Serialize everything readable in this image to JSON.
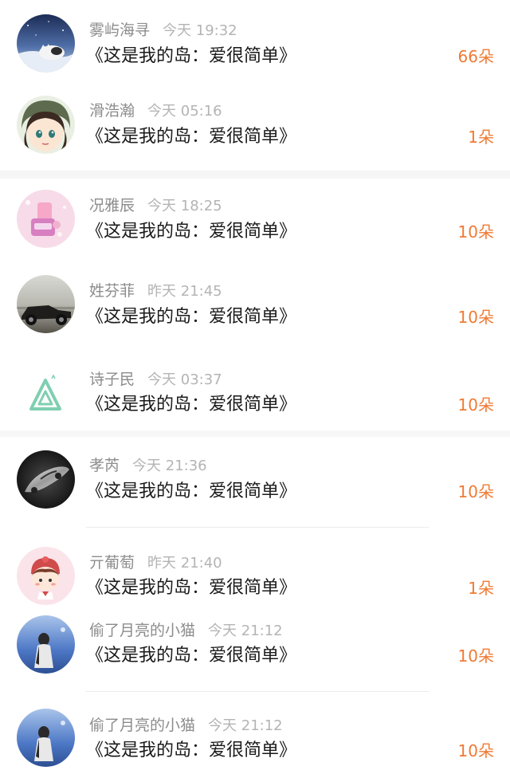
{
  "gift_list": [
    {
      "user": "雾屿海寻",
      "time": "今天 19:32",
      "song": "《这是我的岛：爱很简单》",
      "count": "66朵",
      "avatar": "cat-at-night-avatar"
    },
    {
      "user": "滑浩瀚",
      "time": "今天 05:16",
      "song": "《这是我的岛：爱很简单》",
      "count": "1朵",
      "avatar": "cartoon-girl-avatar"
    },
    {
      "user": "况雅辰",
      "time": "今天 18:25",
      "song": "《这是我的岛：爱很简单》",
      "count": "10朵",
      "avatar": "pink-candy-avatar"
    },
    {
      "user": "姓芬菲",
      "time": "昨天 21:45",
      "song": "《这是我的岛：爱很简单》",
      "count": "10朵",
      "avatar": "vintage-car-avatar"
    },
    {
      "user": "诗子民",
      "time": "今天 03:37",
      "song": "《这是我的岛：爱很简单》",
      "count": "10朵",
      "avatar": "green-triangle-avatar"
    },
    {
      "user": "孝芮",
      "time": "今天 21:36",
      "song": "《这是我的岛：爱很简单》",
      "count": "10朵",
      "avatar": "silver-car-avatar"
    },
    {
      "user": "亓葡萄",
      "time": "昨天 21:40",
      "song": "《这是我的岛：爱很简单》",
      "count": "1朵",
      "avatar": "cartoon-kid-avatar"
    },
    {
      "user": "偷了月亮的小猫",
      "time": "今天 21:12",
      "song": "《这是我的岛：爱很简单》",
      "count": "10朵",
      "avatar": "girl-sea-avatar"
    },
    {
      "user": "偷了月亮的小猫",
      "time": "今天 21:12",
      "song": "《这是我的岛：爱很简单》",
      "count": "10朵",
      "avatar": "girl-sea-avatar"
    }
  ],
  "colors": {
    "accent": "#f07a34",
    "username": "#8c8c8c",
    "timestamp": "#b4b4b4",
    "title": "#1a1a1a"
  }
}
